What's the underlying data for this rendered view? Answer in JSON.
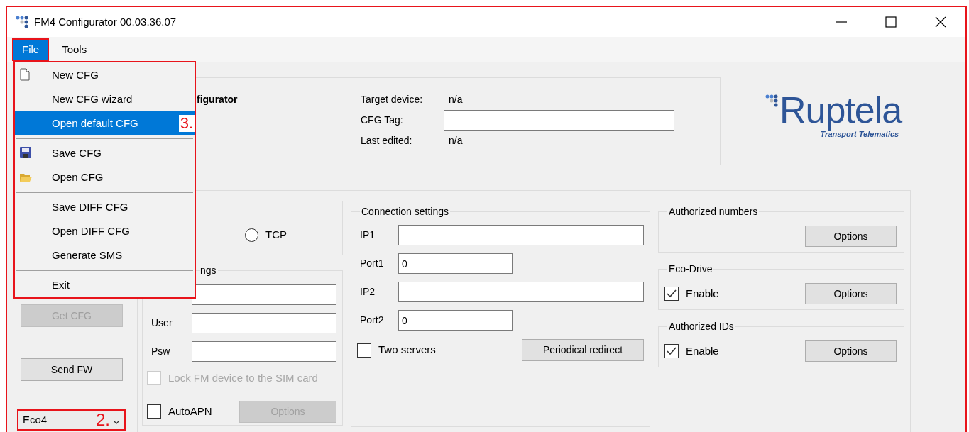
{
  "window": {
    "title": "FM4 Configurator 00.03.36.07",
    "highlighted": true
  },
  "menu_bar": [
    {
      "label": "File",
      "selected": true,
      "highlighted": true
    },
    {
      "label": "Tools",
      "selected": false,
      "highlighted": false
    }
  ],
  "file_menu": {
    "highlighted": true,
    "items": [
      {
        "kind": "item",
        "label": "New CFG",
        "selected": false
      },
      {
        "kind": "item",
        "label": "New CFG wizard",
        "selected": false
      },
      {
        "kind": "item",
        "label": "Open default CFG",
        "selected": true,
        "annotation": "3."
      },
      {
        "kind": "separator"
      },
      {
        "kind": "item",
        "label": "Save CFG",
        "selected": false
      },
      {
        "kind": "item",
        "label": "Open CFG",
        "selected": false
      },
      {
        "kind": "separator"
      },
      {
        "kind": "item",
        "label": "Save DIFF CFG",
        "selected": false
      },
      {
        "kind": "item",
        "label": "Open DIFF CFG",
        "selected": false
      },
      {
        "kind": "item",
        "label": "Generate SMS",
        "selected": false
      },
      {
        "kind": "separator"
      },
      {
        "kind": "item",
        "label": "Exit",
        "selected": false
      }
    ]
  },
  "header": {
    "title": "figurator",
    "fields": [
      {
        "kind": "text",
        "label": "Target device:",
        "value": "n/a"
      },
      {
        "kind": "input",
        "label": "CFG Tag:"
      },
      {
        "kind": "text",
        "label": "Last edited:",
        "value": "n/a"
      }
    ]
  },
  "logo": {
    "name": "Ruptela",
    "tagline": "Transport Telematics"
  },
  "side_buttons": [
    {
      "label": "Get CFG",
      "disabled": true
    },
    {
      "label": "Send FW",
      "disabled": false
    }
  ],
  "device_select": {
    "value": "Eco4",
    "highlighted": true,
    "annotation": "2."
  },
  "protocol": {
    "options": [
      {
        "label": "TCP",
        "selected": false
      }
    ]
  },
  "gprs": {
    "title": "ngs",
    "fields": [
      {
        "kind": "input"
      },
      {
        "kind": "input",
        "label": "User"
      },
      {
        "kind": "input",
        "label": "Psw"
      }
    ],
    "lock_sim": {
      "label": "Lock FM device to the SIM card",
      "checked": false,
      "disabled": true
    },
    "auto_apn": {
      "label": "AutoAPN",
      "checked": false,
      "disabled": false
    },
    "options_button": {
      "label": "Options",
      "disabled": true
    }
  },
  "connection": {
    "title": "Connection settings",
    "fields": [
      {
        "kind": "address",
        "label": "IP1"
      },
      {
        "kind": "port",
        "label": "Port1",
        "value": "0"
      },
      {
        "kind": "address",
        "label": "IP2"
      },
      {
        "kind": "port",
        "label": "Port2",
        "value": "0"
      }
    ],
    "two_servers": {
      "label": "Two servers",
      "checked": false,
      "disabled": false
    },
    "redirect_button": {
      "label": "Periodical redirect",
      "disabled": false
    }
  },
  "right_groups": [
    {
      "title": "Authorized numbers",
      "button": "Options"
    },
    {
      "title": "Eco-Drive",
      "enable": {
        "label": "Enable",
        "checked": true,
        "disabled": false
      },
      "button": "Options"
    },
    {
      "title": "Authorized IDs",
      "enable": {
        "label": "Enable",
        "checked": true,
        "disabled": false
      },
      "button": "Options"
    }
  ]
}
